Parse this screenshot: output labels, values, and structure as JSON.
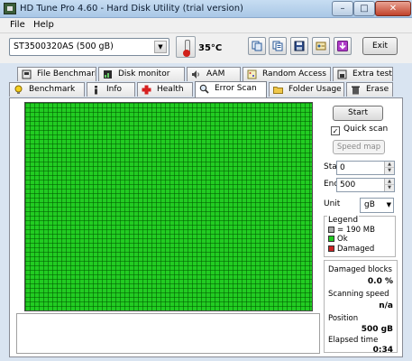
{
  "window": {
    "title": "HD Tune Pro 4.60 - Hard Disk Utility (trial version)",
    "minimize": "–",
    "maximize": "□",
    "close": "✕"
  },
  "menu": {
    "file": "File",
    "help": "Help"
  },
  "toolbar": {
    "drive": "ST3500320AS (500 gB)",
    "temperature": "35°C",
    "exit_label": "Exit",
    "icons": [
      "copy-icon",
      "copy-text-icon",
      "save-icon",
      "options-icon",
      "download-icon"
    ]
  },
  "tabs": {
    "row1": [
      "File Benchmark",
      "Disk monitor",
      "AAM",
      "Random Access",
      "Extra tests"
    ],
    "row2": [
      "Benchmark",
      "Info",
      "Health",
      "Error Scan",
      "Folder Usage",
      "Erase"
    ],
    "active": "Error Scan"
  },
  "scan": {
    "start_label": "Start",
    "quick_scan_label": "Quick scan",
    "quick_scan_checked": true,
    "check_mark": "✓",
    "speed_map_label": "Speed map",
    "start_field_label": "Start",
    "start_value": "0",
    "end_field_label": "End",
    "end_value": "500",
    "unit_label": "Unit",
    "unit_value": "gB"
  },
  "legend": {
    "title": "Legend",
    "items": [
      {
        "label": "= 190 MB",
        "color": "#aaaaaa"
      },
      {
        "label": "Ok",
        "color": "#22cc22"
      },
      {
        "label": "Damaged",
        "color": "#cc2222"
      }
    ]
  },
  "stats": {
    "damaged_blocks_label": "Damaged blocks",
    "damaged_blocks_value": "0.0 %",
    "scanning_speed_label": "Scanning speed",
    "scanning_speed_value": "n/a",
    "position_label": "Position",
    "position_value": "500 gB",
    "elapsed_label": "Elapsed time",
    "elapsed_value": "0:34"
  },
  "colors": {
    "ok_block": "#22cc22",
    "grid_line": "#005a00"
  }
}
